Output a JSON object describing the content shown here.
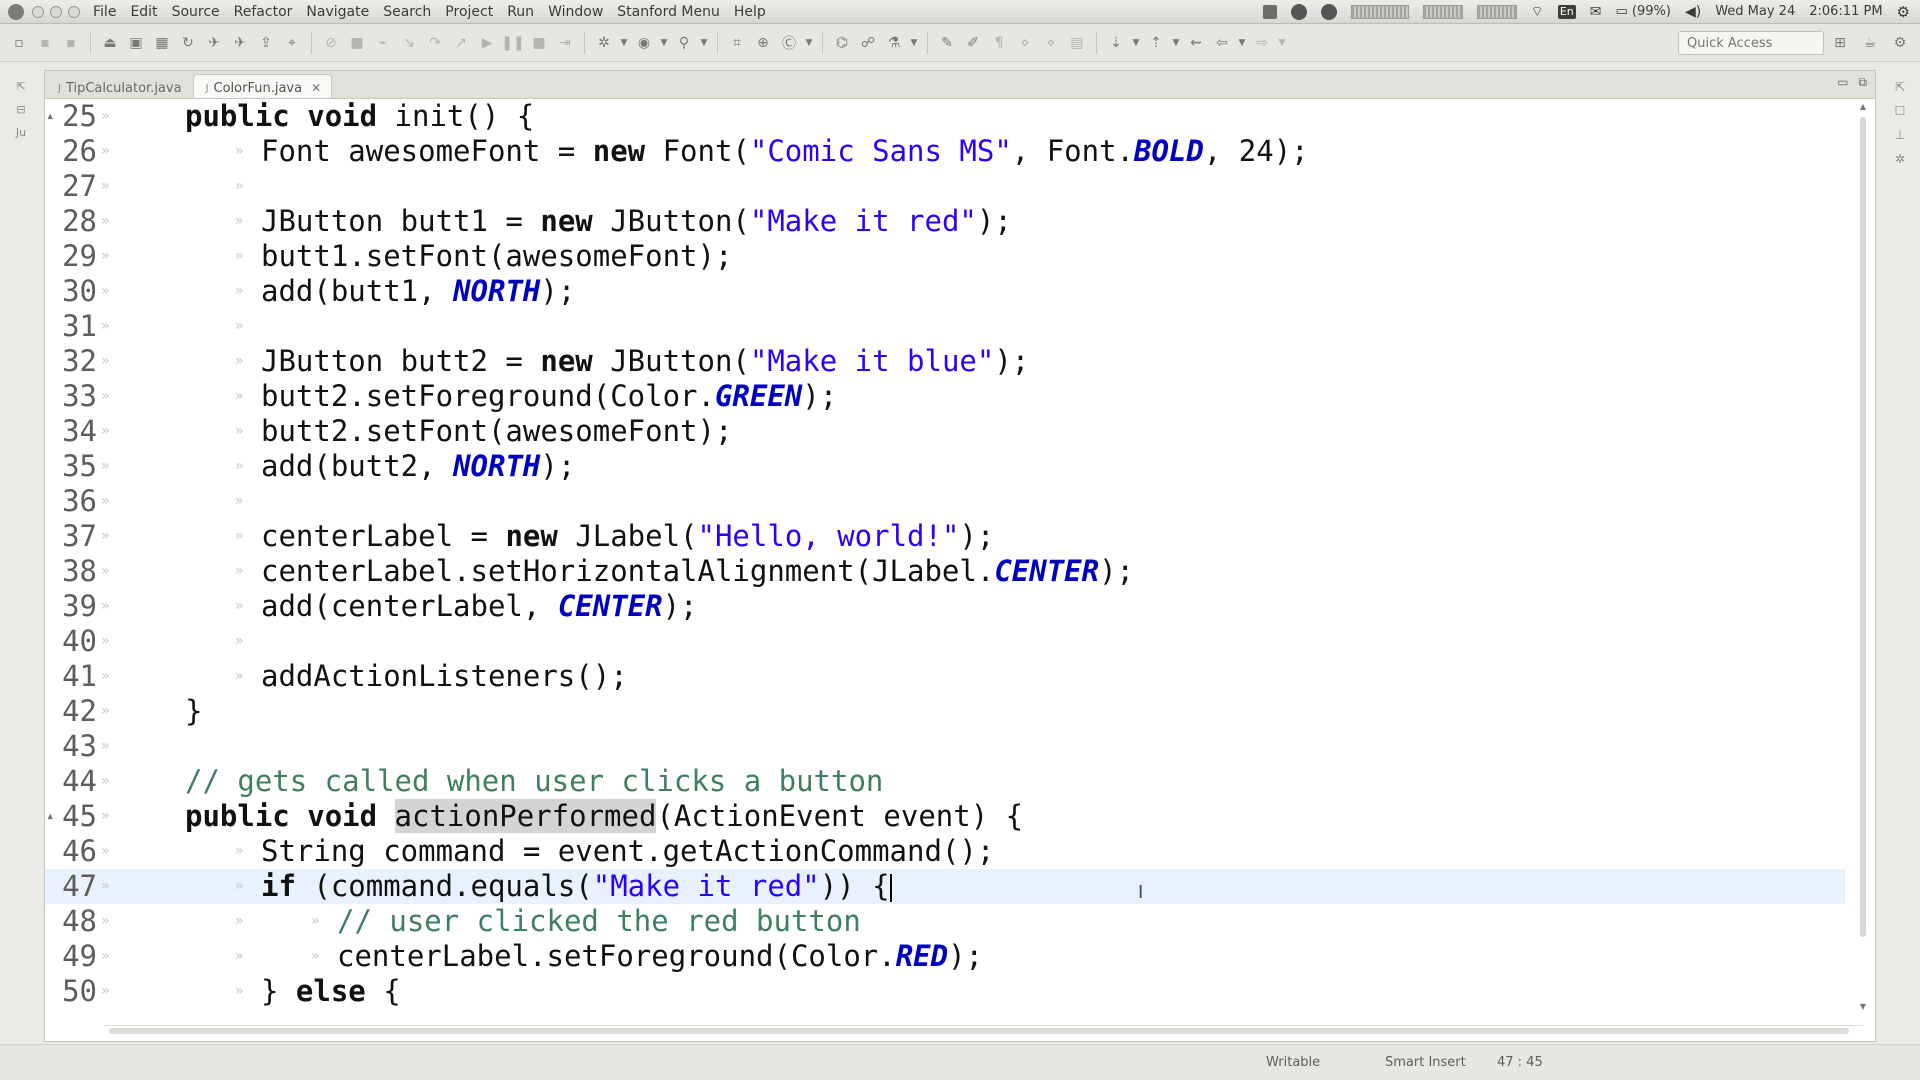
{
  "menubar": {
    "items": [
      "File",
      "Edit",
      "Source",
      "Refactor",
      "Navigate",
      "Search",
      "Project",
      "Run",
      "Window",
      "Stanford Menu",
      "Help"
    ],
    "tray": {
      "keyboard": "En",
      "battery": "(99%)",
      "date": "Wed May 24",
      "time": "2:06:11 PM"
    }
  },
  "toolbar": {
    "quick_access_placeholder": "Quick Access"
  },
  "tabs": [
    {
      "label": "TipCalculator.java",
      "active": false
    },
    {
      "label": "ColorFun.java",
      "active": true
    }
  ],
  "code": {
    "lines": [
      {
        "n": "25",
        "text": "public void init() {"
      },
      {
        "n": "26",
        "text": "Font awesomeFont = new Font(\"Comic Sans MS\", Font.BOLD, 24);"
      },
      {
        "n": "27",
        "text": ""
      },
      {
        "n": "28",
        "text": "JButton butt1 = new JButton(\"Make it red\");"
      },
      {
        "n": "29",
        "text": "butt1.setFont(awesomeFont);"
      },
      {
        "n": "30",
        "text": "add(butt1, NORTH);"
      },
      {
        "n": "31",
        "text": ""
      },
      {
        "n": "32",
        "text": "JButton butt2 = new JButton(\"Make it blue\");"
      },
      {
        "n": "33",
        "text": "butt2.setForeground(Color.GREEN);"
      },
      {
        "n": "34",
        "text": "butt2.setFont(awesomeFont);"
      },
      {
        "n": "35",
        "text": "add(butt2, NORTH);"
      },
      {
        "n": "36",
        "text": ""
      },
      {
        "n": "37",
        "text": "centerLabel = new JLabel(\"Hello, world!\");"
      },
      {
        "n": "38",
        "text": "centerLabel.setHorizontalAlignment(JLabel.CENTER);"
      },
      {
        "n": "39",
        "text": "add(centerLabel, CENTER);"
      },
      {
        "n": "40",
        "text": ""
      },
      {
        "n": "41",
        "text": "addActionListeners();"
      },
      {
        "n": "42",
        "text": "}"
      },
      {
        "n": "43",
        "text": ""
      },
      {
        "n": "44",
        "text": "// gets called when user clicks a button"
      },
      {
        "n": "45",
        "text": "public void actionPerformed(ActionEvent event) {"
      },
      {
        "n": "46",
        "text": "String command = event.getActionCommand();"
      },
      {
        "n": "47",
        "text": "if (command.equals(\"Make it red\")) {"
      },
      {
        "n": "48",
        "text": "// user clicked the red button"
      },
      {
        "n": "49",
        "text": "centerLabel.setForeground(Color.RED);"
      },
      {
        "n": "50",
        "text": "} else {"
      }
    ]
  },
  "status": {
    "writable": "Writable",
    "insert_mode": "Smart Insert",
    "position": "47 : 45"
  },
  "colors": {
    "keyword": "#111111",
    "string": "#2a00ff",
    "constant": "#0000c0",
    "comment": "#3f7f5f",
    "current_line": "#e8f2fe"
  }
}
